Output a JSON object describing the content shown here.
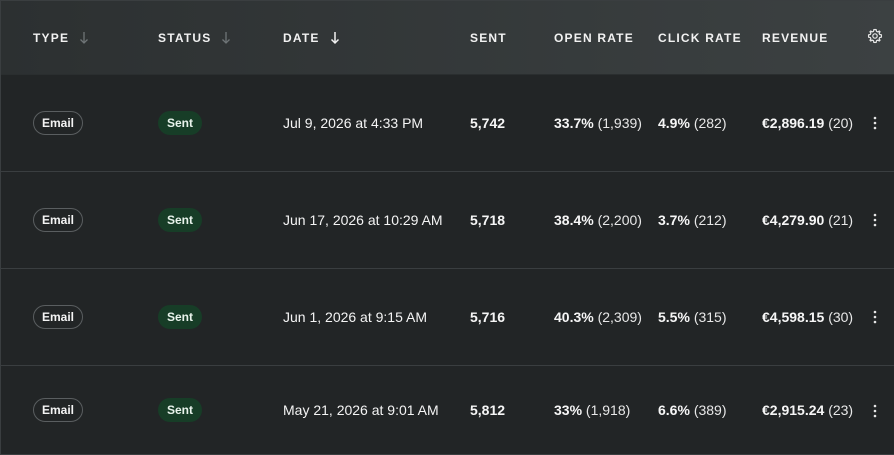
{
  "columns": {
    "type": "TYPE",
    "status": "STATUS",
    "date": "DATE",
    "sent": "SENT",
    "open_rate": "OPEN RATE",
    "click_rate": "CLICK RATE",
    "revenue": "REVENUE"
  },
  "sort": {
    "type_icon": "arrow-down-icon",
    "status_icon": "arrow-down-icon",
    "date_icon": "arrow-down-icon",
    "active_column": "date"
  },
  "settings_icon": "gear-icon",
  "row_menu_icon": "kebab-icon",
  "colors": {
    "header_bg_start": "#2c3031",
    "header_bg_end": "#3c4142",
    "row_bg": "#222526",
    "status_sent_bg": "#173d27",
    "divider": "#3a3e40"
  },
  "rows": [
    {
      "type": "Email",
      "status": "Sent",
      "date": "Jul 9, 2026 at 4:33 PM",
      "sent": "5,742",
      "open_rate": "33.7%",
      "open_count": "(1,939)",
      "click_rate": "4.9%",
      "click_count": "(282)",
      "revenue": "€2,896.19",
      "revenue_count": "(20)"
    },
    {
      "type": "Email",
      "status": "Sent",
      "date": "Jun 17, 2026 at 10:29 AM",
      "sent": "5,718",
      "open_rate": "38.4%",
      "open_count": "(2,200)",
      "click_rate": "3.7%",
      "click_count": "(212)",
      "revenue": "€4,279.90",
      "revenue_count": "(21)"
    },
    {
      "type": "Email",
      "status": "Sent",
      "date": "Jun 1, 2026 at 9:15 AM",
      "sent": "5,716",
      "open_rate": "40.3%",
      "open_count": "(2,309)",
      "click_rate": "5.5%",
      "click_count": "(315)",
      "revenue": "€4,598.15",
      "revenue_count": "(30)"
    },
    {
      "type": "Email",
      "status": "Sent",
      "date": "May 21, 2026 at 9:01 AM",
      "sent": "5,812",
      "open_rate": "33%",
      "open_count": "(1,918)",
      "click_rate": "6.6%",
      "click_count": "(389)",
      "revenue": "€2,915.24",
      "revenue_count": "(23)"
    }
  ]
}
